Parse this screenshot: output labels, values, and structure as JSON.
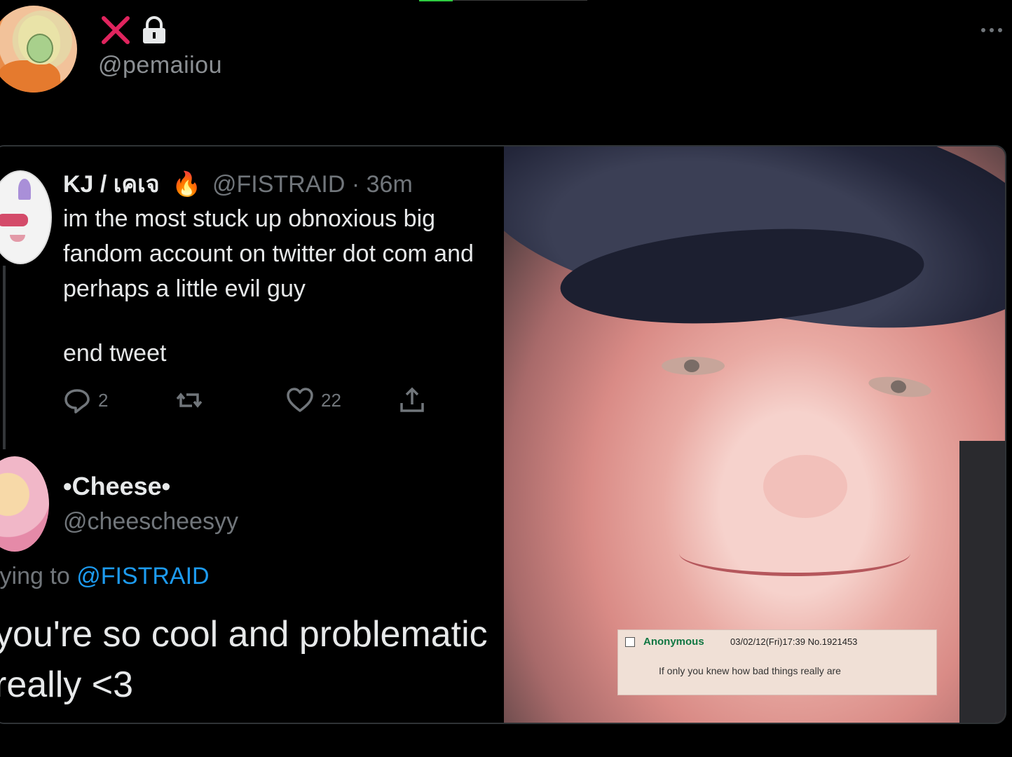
{
  "outer": {
    "handle": "@pemaiiou"
  },
  "quoted_tweet": {
    "display_name": "KJ / เคเจ",
    "emoji": "🔥",
    "handle": "@FISTRAID",
    "separator": "·",
    "time": "36m",
    "text": "im the most stuck up obnoxious big fandom account on twitter dot com and perhaps a little evil guy",
    "text_end": "end tweet",
    "reply_count": "2",
    "like_count": "22"
  },
  "reply": {
    "display_name": "•Cheese•",
    "handle": "@cheescheesyy",
    "replying_prefix": "lying to ",
    "replying_mention": "@FISTRAID",
    "text": "you're so cool and problematic really <3"
  },
  "image_caption": {
    "name": "Anonymous",
    "meta": "03/02/12(Fri)17:39 No.1921453",
    "body": "If only you knew how bad things really are"
  },
  "colors": {
    "background": "#000000",
    "text": "#e7e9ea",
    "muted": "#71767b",
    "link": "#1d9bf0",
    "x_red": "#e0245e"
  },
  "icons": [
    "x-close-icon",
    "lock-icon",
    "more-icon",
    "reply-icon",
    "retweet-icon",
    "like-icon",
    "share-icon"
  ]
}
